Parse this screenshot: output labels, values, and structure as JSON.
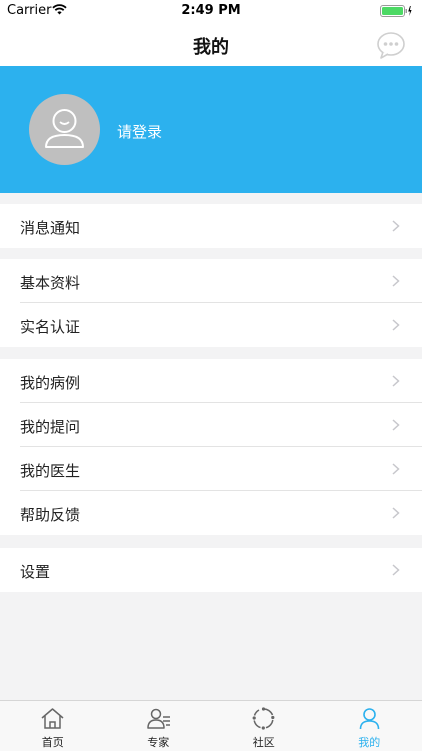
{
  "status_bar": {
    "carrier": "Carrier",
    "time": "2:49 PM"
  },
  "nav": {
    "title": "我的"
  },
  "profile": {
    "login_text": "请登录"
  },
  "menu_groups": [
    [
      "消息通知"
    ],
    [
      "基本资料",
      "实名认证"
    ],
    [
      "我的病例",
      "我的提问",
      "我的医生",
      "帮助反馈"
    ],
    [
      "设置"
    ]
  ],
  "tab_bar": {
    "tabs": [
      {
        "label": "首页",
        "icon": "home-icon"
      },
      {
        "label": "专家",
        "icon": "experts-icon"
      },
      {
        "label": "社区",
        "icon": "community-icon"
      },
      {
        "label": "我的",
        "icon": "profile-icon"
      }
    ],
    "active_index": 3
  },
  "colors": {
    "accent": "#2cb1ee",
    "avatar_bg": "#bfbfbf",
    "battery": "#4cd964"
  }
}
